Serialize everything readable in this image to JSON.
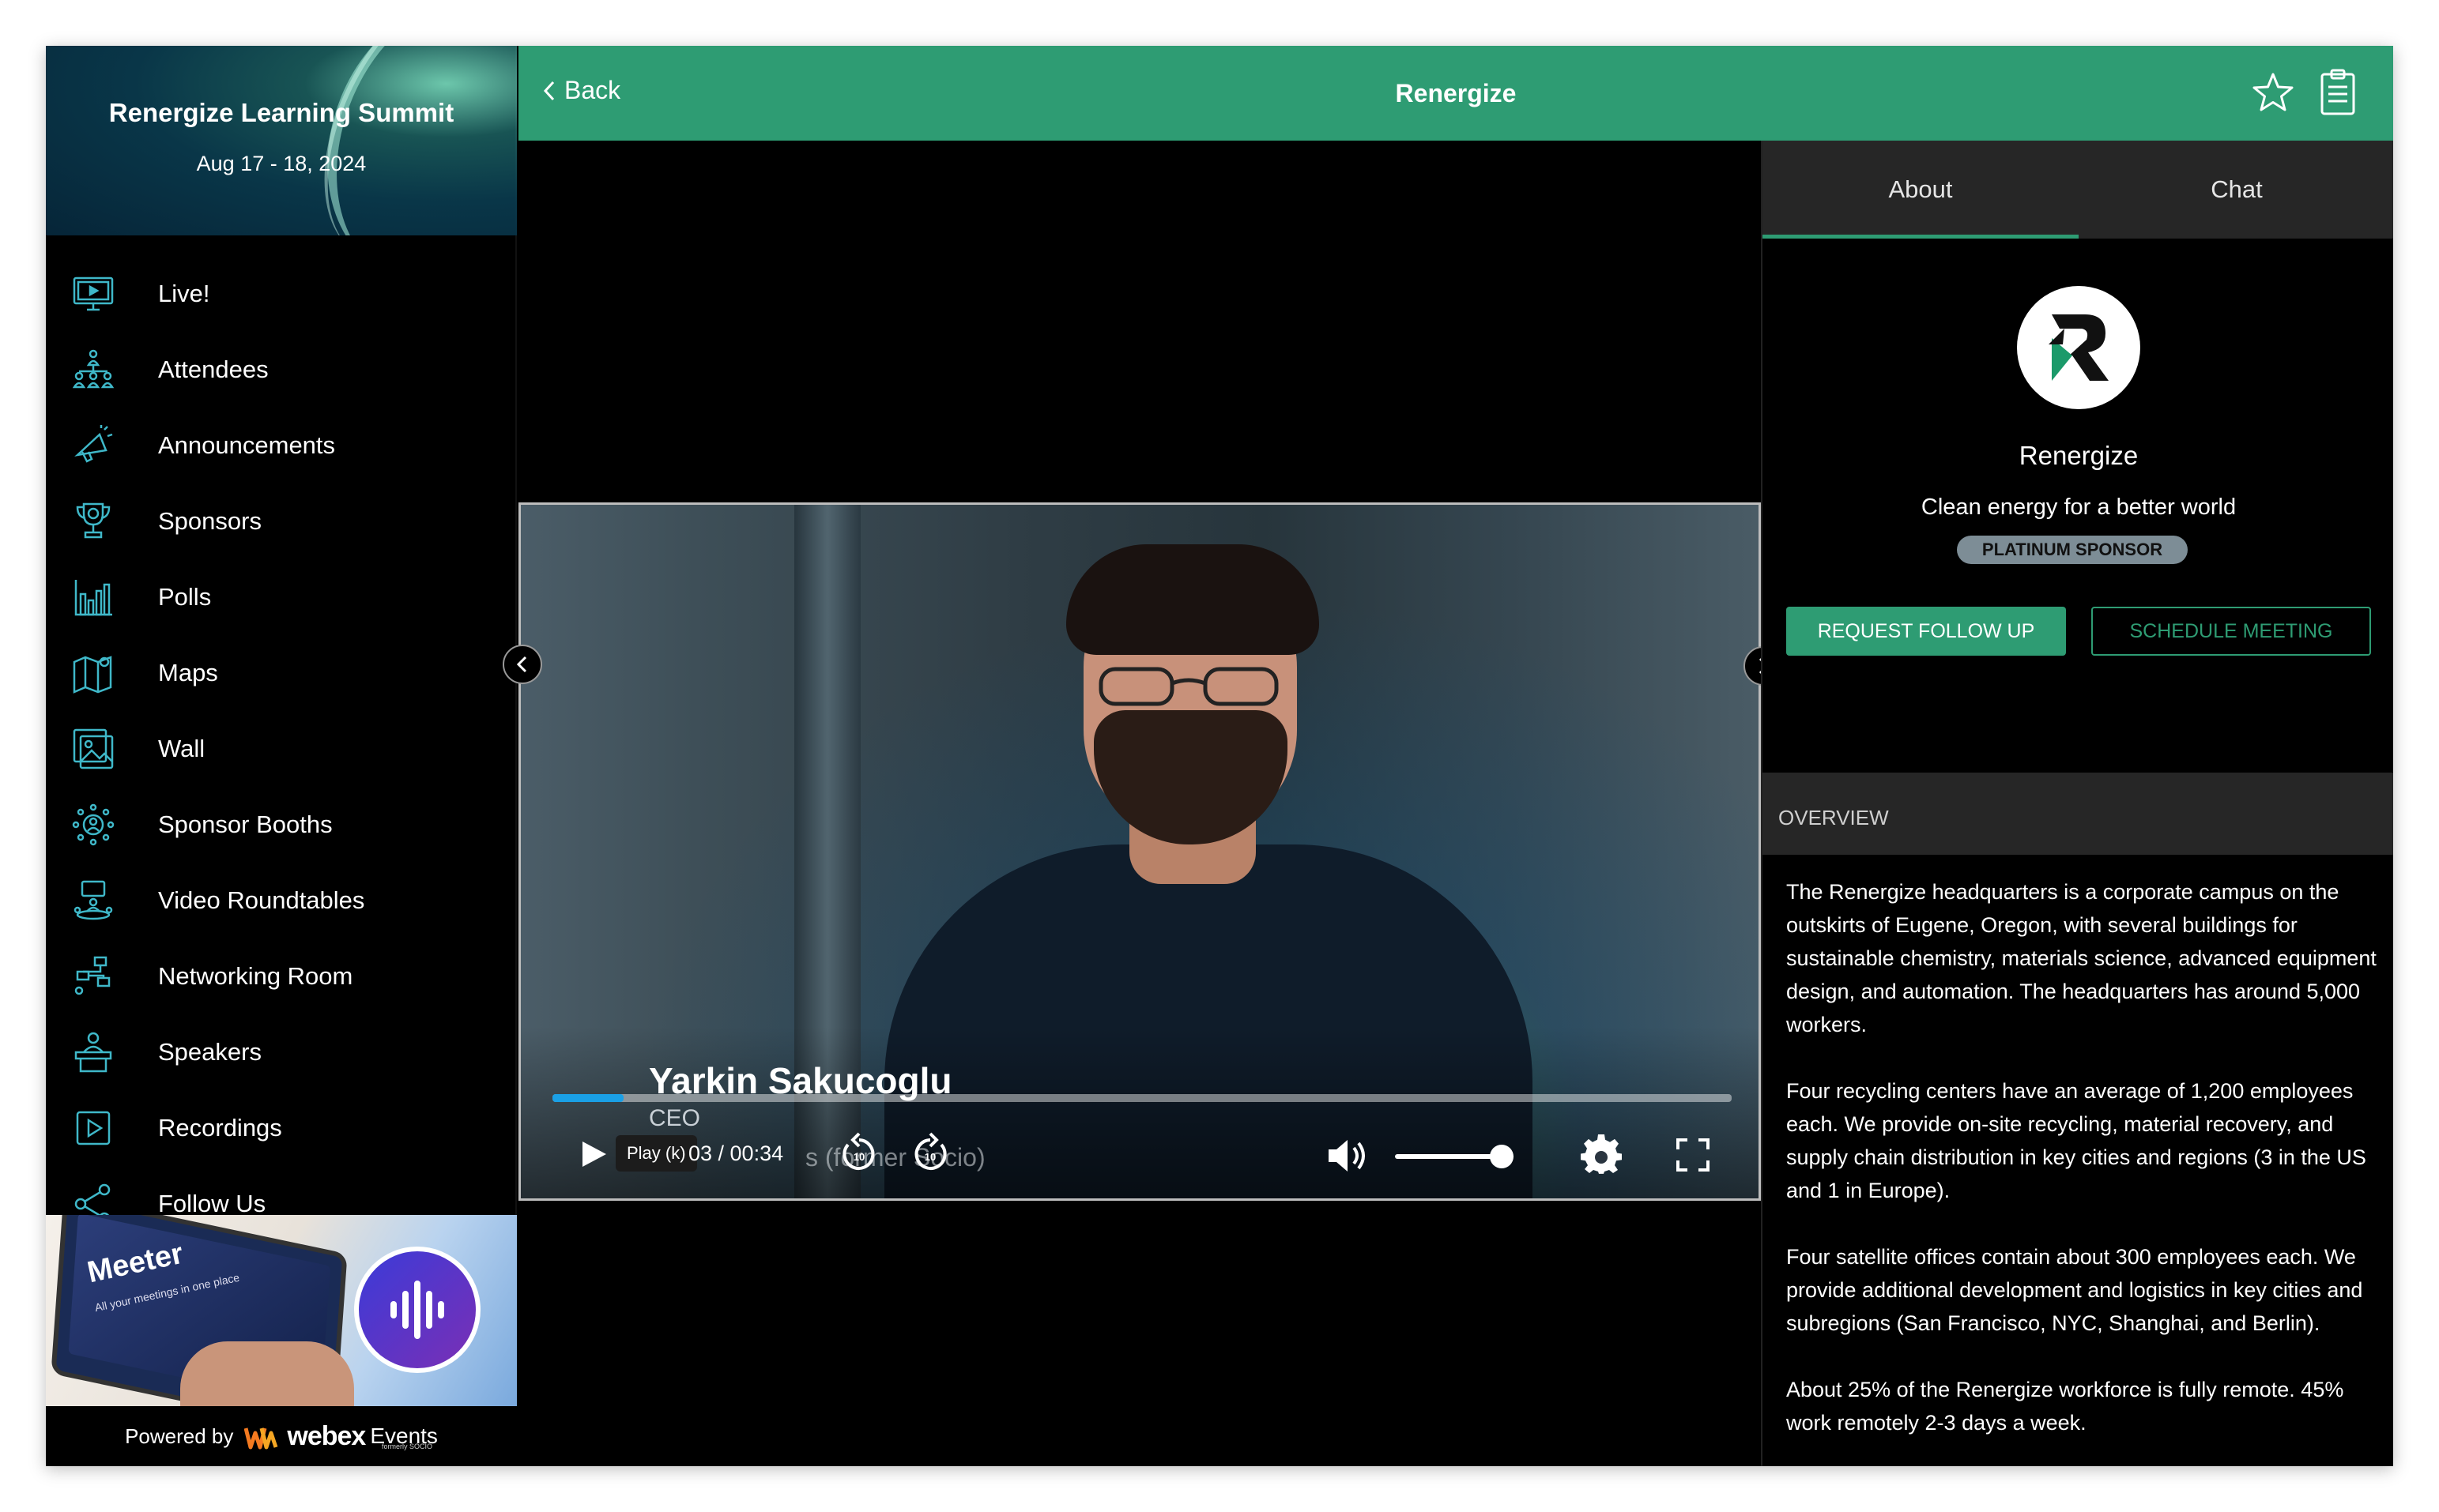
{
  "sidebar": {
    "event_title": "Renergize Learning Summit",
    "event_dates": "Aug 17 - 18, 2024",
    "items": [
      {
        "label": "Live!",
        "icon": "monitor-icon"
      },
      {
        "label": "Attendees",
        "icon": "people-network-icon"
      },
      {
        "label": "Announcements",
        "icon": "megaphone-icon"
      },
      {
        "label": "Sponsors",
        "icon": "trophy-icon"
      },
      {
        "label": "Polls",
        "icon": "bar-chart-icon"
      },
      {
        "label": "Maps",
        "icon": "map-icon"
      },
      {
        "label": "Wall",
        "icon": "photo-wall-icon"
      },
      {
        "label": "Sponsor Booths",
        "icon": "booth-icon"
      },
      {
        "label": "Video Roundtables",
        "icon": "roundtable-icon"
      },
      {
        "label": "Networking Room",
        "icon": "networking-icon"
      },
      {
        "label": "Speakers",
        "icon": "podium-icon"
      },
      {
        "label": "Recordings",
        "icon": "play-square-icon"
      },
      {
        "label": "Follow Us",
        "icon": "share-icon"
      }
    ],
    "ad": {
      "brand": "Meeter",
      "tagline": "All your meetings in one place"
    },
    "powered_by": "Powered by",
    "webex_word": "webex",
    "webex_events": "Events",
    "webex_formerly": "formerly SOCIO"
  },
  "topbar": {
    "back_label": "Back",
    "title": "Renergize"
  },
  "video": {
    "speaker_name": "Yarkin Sakucoglu",
    "speaker_role": "CEO",
    "subtitle_fragment": "s (former Socio)",
    "tooltip": "Play (k)",
    "time": "03 / 00:34",
    "progress": 0.06,
    "volume": 0.9
  },
  "panel": {
    "tabs": [
      {
        "label": "About"
      },
      {
        "label": "Chat"
      }
    ],
    "sponsor_name": "Renergize",
    "sponsor_tagline": "Clean energy for a better world",
    "badge": "PLATINUM SPONSOR",
    "request_label": "REQUEST FOLLOW UP",
    "schedule_label": "SCHEDULE MEETING",
    "overview_label": "OVERVIEW",
    "overview_paragraphs": [
      "The Renergize headquarters is a corporate campus on the outskirts of Eugene, Oregon, with several buildings for sustainable chemistry, materials science, advanced equipment design, and automation. The headquarters has around 5,000 workers.",
      "Four recycling centers have an average of 1,200 employees each. We provide on-site recycling, material recovery, and supply chain distribution in key cities and regions (3 in the US and 1 in Europe).",
      "Four satellite offices contain about 300 employees each. We provide additional development and logistics in key cities and subregions (San Francisco, NYC, Shanghai, and Berlin).",
      "About 25% of the Renergize workforce is fully remote. 45% work remotely 2-3 days a week."
    ]
  },
  "colors": {
    "accent": "#2e9c73",
    "progress": "#1aa0e6",
    "icon": "#3fb8c9"
  }
}
